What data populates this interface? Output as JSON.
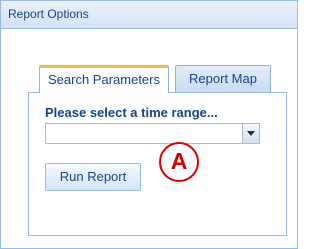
{
  "panel": {
    "title": "Report Options"
  },
  "tabs": [
    {
      "label": "Search Parameters",
      "active": true
    },
    {
      "label": "Report Map",
      "active": false
    }
  ],
  "form": {
    "time_range_label": "Please select a time range...",
    "time_range_value": "",
    "run_button_label": "Run Report"
  },
  "annotation": {
    "marker_label": "A"
  },
  "colors": {
    "header_text": "#15428b",
    "border": "#99bbe8",
    "active_tab_accent": "#f5b64b",
    "marker": "#d80000"
  },
  "icons": {
    "combo_trigger": "chevron-down-icon"
  }
}
